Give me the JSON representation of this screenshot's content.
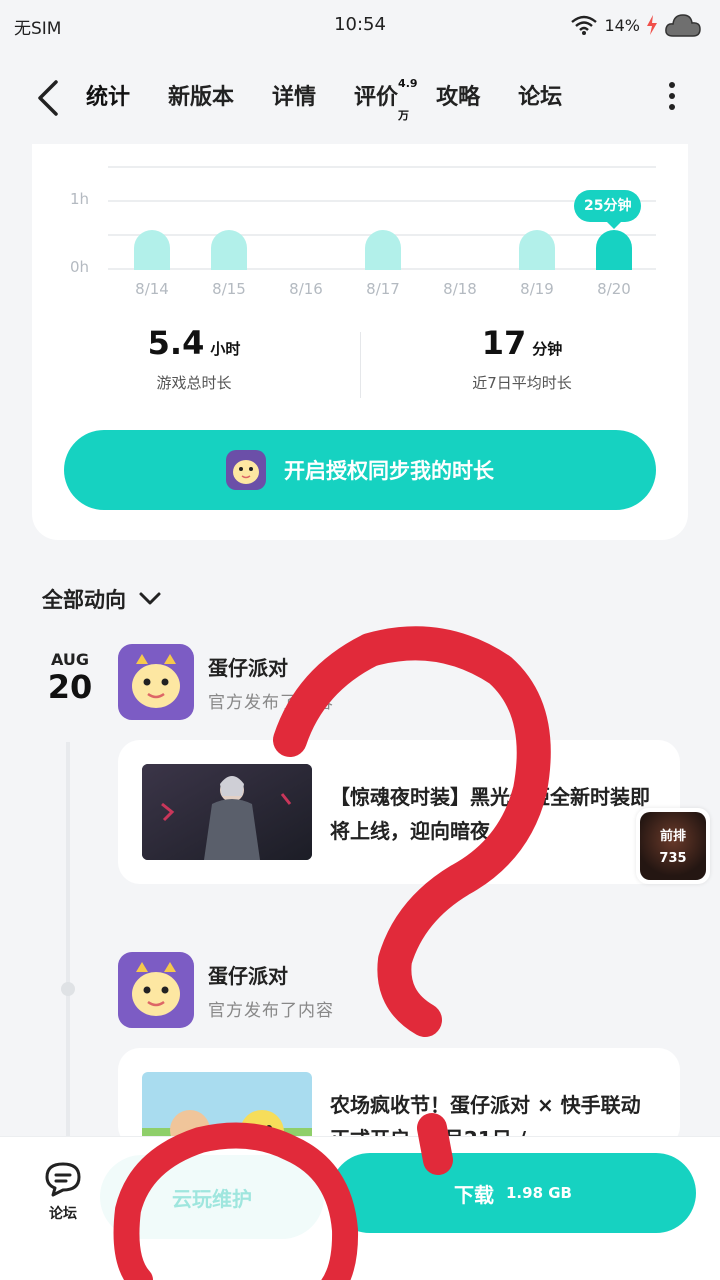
{
  "status_bar": {
    "carrier": "无SIM",
    "time": "10:54",
    "battery": "14%"
  },
  "nav": {
    "tabs": [
      {
        "label": "统计",
        "active": true
      },
      {
        "label": "新版本"
      },
      {
        "label": "详情"
      },
      {
        "label": "评价",
        "badge": "4.9万"
      },
      {
        "label": "攻略"
      },
      {
        "label": "论坛"
      }
    ]
  },
  "chart_data": {
    "type": "bar",
    "categories": [
      "8/14",
      "8/15",
      "8/16",
      "8/17",
      "8/18",
      "8/19",
      "8/20"
    ],
    "values_minutes": [
      25,
      25,
      0,
      25,
      0,
      25,
      25
    ],
    "y_ticks": [
      "0h",
      "1h"
    ],
    "highlight": {
      "category": "8/20",
      "label": "25分钟"
    },
    "colors": {
      "bar": "#b2f0ea",
      "highlight": "#17d2c2"
    }
  },
  "stats": {
    "total": {
      "value": "5.4",
      "unit": "小时",
      "caption": "游戏总时长"
    },
    "average": {
      "value": "17",
      "unit": "分钟",
      "caption": "近7日平均时长"
    }
  },
  "sync_button": {
    "label": "开启授权同步我的时长"
  },
  "feed": {
    "filter_label": "全部动向",
    "date": {
      "month": "AUG",
      "day": "20"
    },
    "posts": [
      {
        "author": "蛋仔派对",
        "subtitle": "官方发布了内容",
        "text": "【惊魂夜时装】黑光佩姬全新时装即将上线，迎向暗夜…"
      },
      {
        "author": "蛋仔派对",
        "subtitle": "官方发布了内容",
        "text": "农场疯收节！蛋仔派对 × 快手联动正式开启，8月21日 /"
      }
    ],
    "float_badge": {
      "line1": "前排",
      "line2": "735"
    }
  },
  "bottom_bar": {
    "forum_label": "论坛",
    "cloud_label": "云玩维护",
    "download_label": "下载",
    "download_size": "1.98 GB"
  },
  "colors": {
    "accent": "#16d2c1",
    "scribble": "#e12a3a"
  }
}
